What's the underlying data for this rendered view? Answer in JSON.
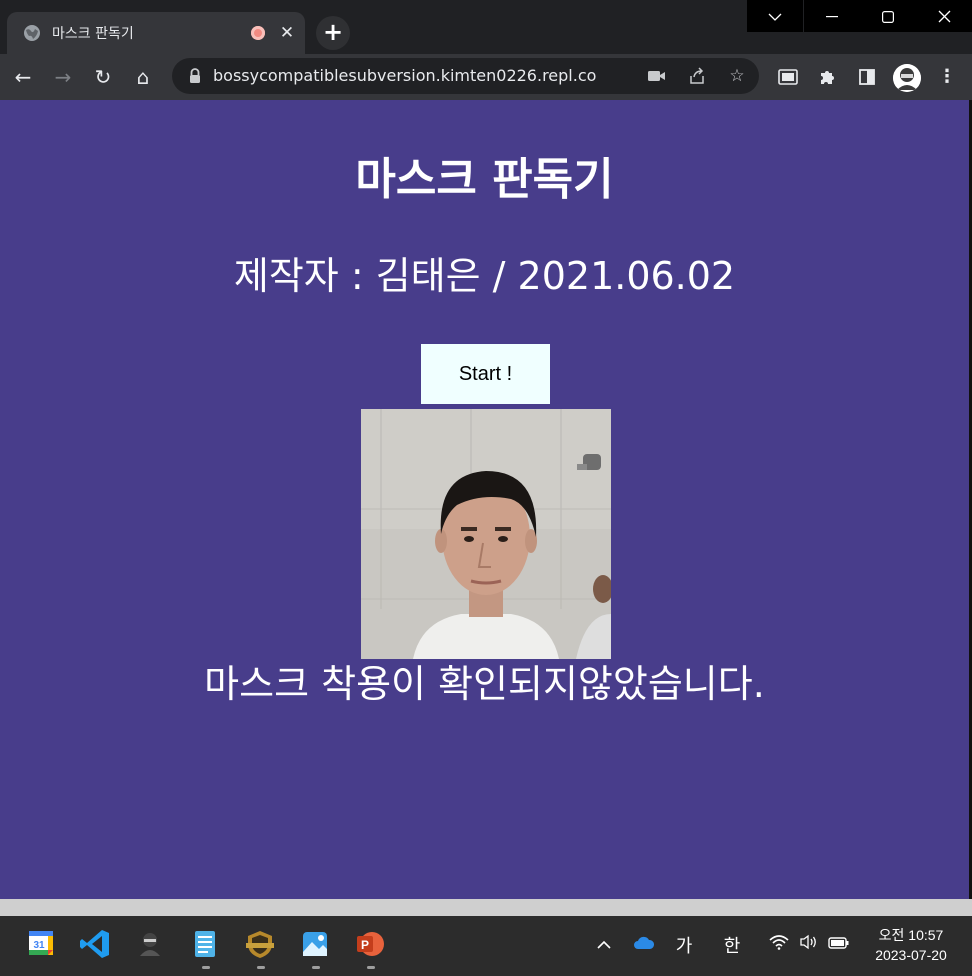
{
  "browser": {
    "tab_title": "마스크 판독기",
    "tab_close": "✕",
    "new_tab": "+",
    "url": "bossycompatiblesubversion.kimten0226.repl.co",
    "window_controls": {
      "dropdown": "⌄",
      "minimize": "—",
      "maximize": "☐",
      "close": "✕"
    },
    "nav": {
      "back": "←",
      "forward": "→",
      "reload": "↻",
      "home": "⌂"
    },
    "omnibox_icons": {
      "camera": "■",
      "share": "⇧",
      "bookmark": "☆"
    },
    "extensions": {
      "media": "▣",
      "puzzle": "✱",
      "side_panel": "▮",
      "menu": "⋮"
    }
  },
  "page": {
    "title": "마스크 판독기",
    "subtitle": "제작자 : 김태은 / 2021.06.02",
    "start_button": "Start !",
    "result_text": "마스크 착용이 확인되지않았습니다."
  },
  "taskbar": {
    "tray": {
      "chevron": "^",
      "ime_1": "가",
      "ime_2": "한"
    },
    "clock_time": "오전 10:57",
    "clock_date": "2023-07-20",
    "calendar_day": "31"
  }
}
